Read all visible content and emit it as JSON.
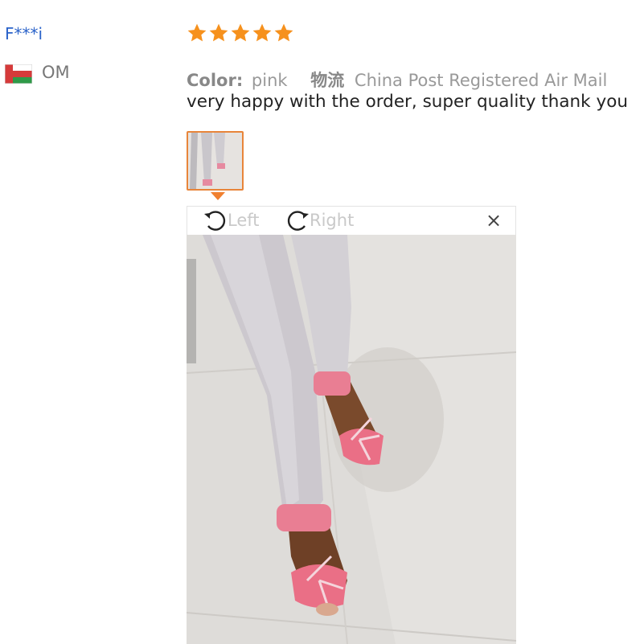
{
  "reviewer": {
    "name": "F***i",
    "country_code": "OM",
    "flag_colors": [
      "#d63a3a",
      "#ffffff",
      "#2f9a48"
    ]
  },
  "review": {
    "rating": 5,
    "max_rating": 5,
    "star_color": "#f6911d",
    "color_label": "Color:",
    "color_value": "pink",
    "shipping_label": "物流",
    "shipping_value": "China Post Registered Air Mail",
    "text": "very happy with the order, super quality thank you"
  },
  "viewer": {
    "rotate_left_label": "Left",
    "rotate_right_label": "Right",
    "close_label": "×",
    "accent_color": "#f08030",
    "icons": {
      "rotate_left": "rotate-left-icon",
      "rotate_right": "rotate-right-icon",
      "close": "close-icon"
    }
  }
}
